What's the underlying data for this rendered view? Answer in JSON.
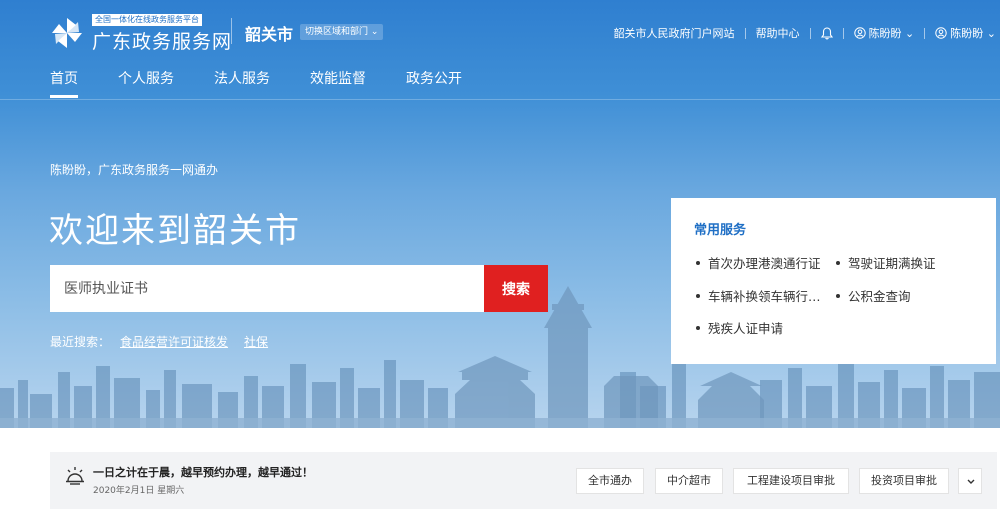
{
  "header": {
    "platform_tag": "全国一体化在线政务服务平台",
    "site_name": "广东政务服务网",
    "city": "韶关市",
    "region_switch": "切换区域和部门 ⌄",
    "links": [
      "韶关市人民政府门户网站",
      "帮助中心"
    ],
    "user_1": "陈盼盼 ⌄",
    "user_2": "陈盼盼 ⌄"
  },
  "nav": [
    "首页",
    "个人服务",
    "法人服务",
    "效能监督",
    "政务公开"
  ],
  "hero": {
    "greeting": "陈盼盼，广东政务服务一网通办",
    "welcome": "欢迎来到韶关市"
  },
  "search": {
    "placeholder": "医师执业证书",
    "button": "搜索",
    "recent_label": "最近搜索：",
    "recent": [
      "食品经营许可证核发",
      "社保"
    ]
  },
  "common_services": {
    "title": "常用服务",
    "items": [
      "首次办理港澳通行证",
      "驾驶证期满换证",
      "车辆补换领车辆行…",
      "公积金查询",
      "残疾人证申请"
    ]
  },
  "notice": {
    "title": "一日之计在于晨，越早预约办理，越早通过！",
    "date": "2020年2月1日 星期六"
  },
  "quick_links": [
    "全市通办",
    "中介超市",
    "工程建设项目审批",
    "投资项目审批"
  ],
  "colors": {
    "brand_blue": "#1f6fc5",
    "search_red": "#e02020",
    "bar_gray": "#f2f3f5"
  }
}
